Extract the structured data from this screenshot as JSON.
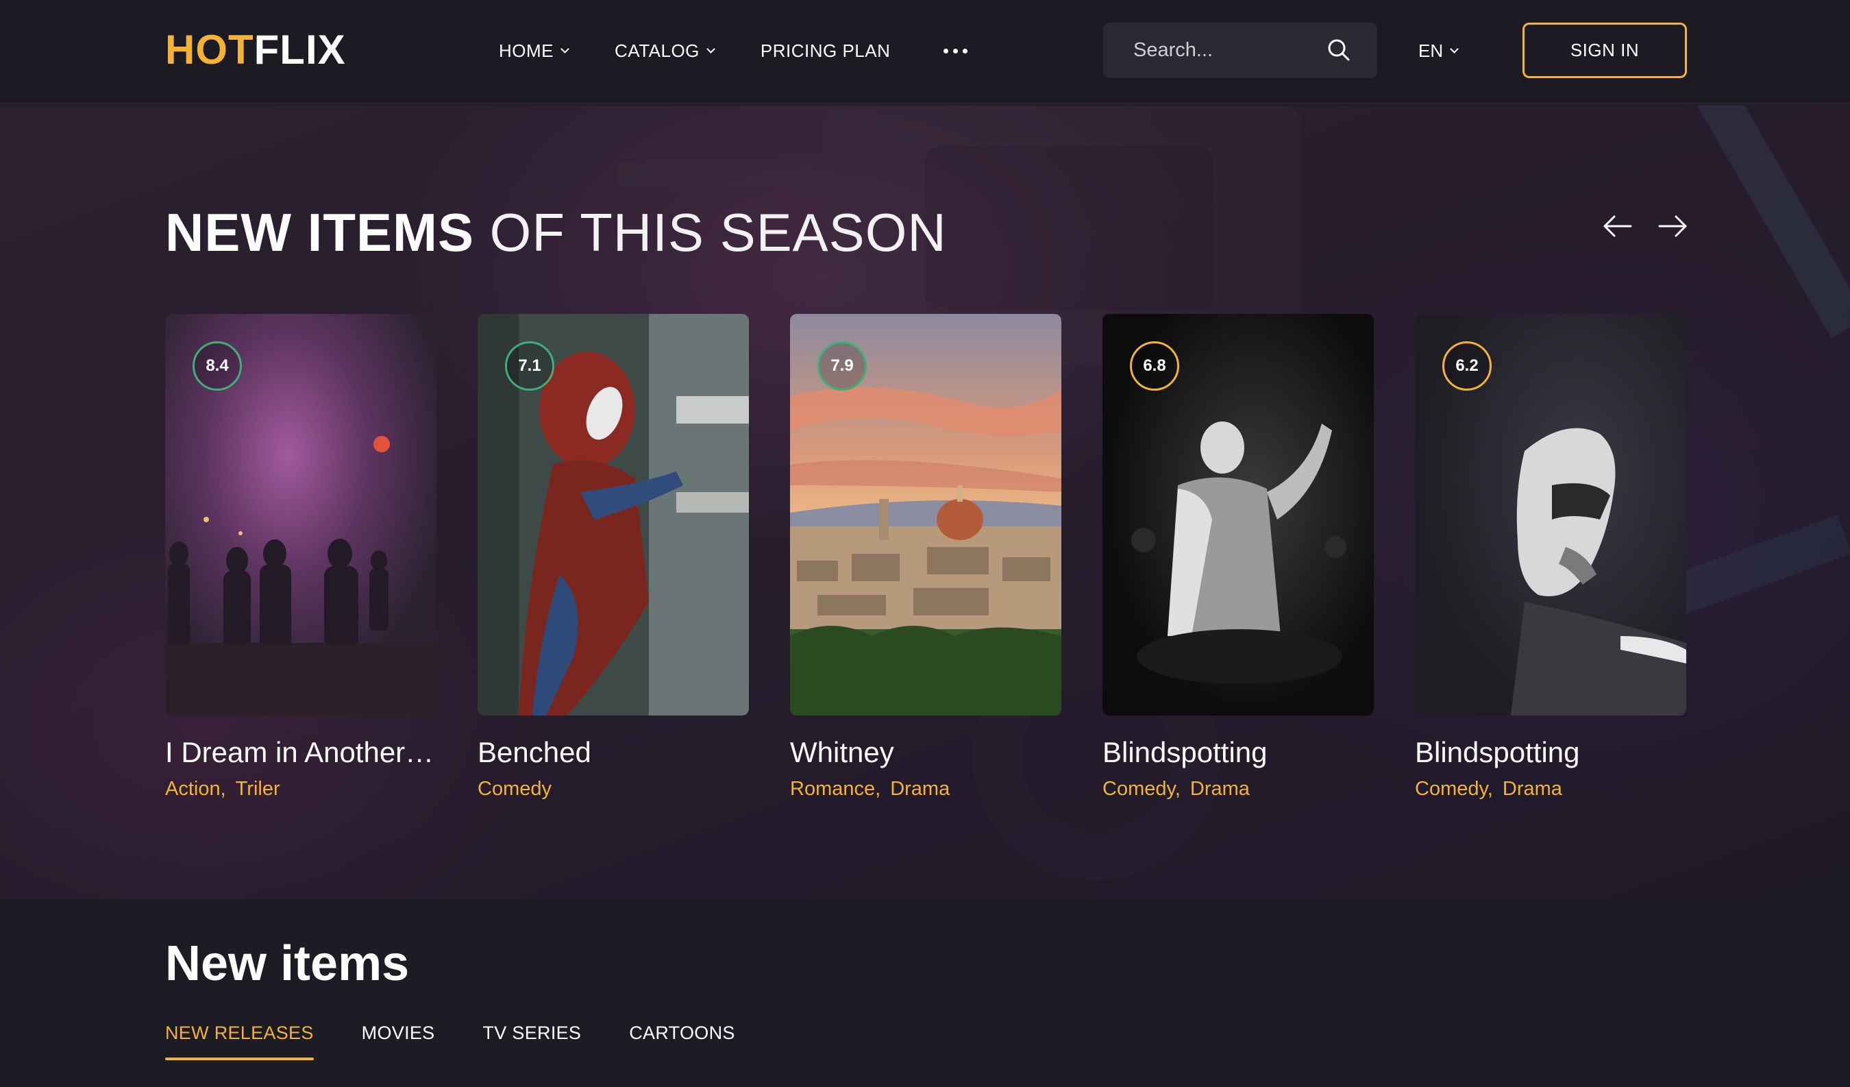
{
  "colors": {
    "accent": "#f5b335",
    "rating_green": "#3fb075",
    "rating_yellow": "#f5b335",
    "header_bg": "#1c1a22",
    "page_bg": "#1f1d26"
  },
  "header": {
    "logo_part1": "HOT",
    "logo_part2": "FLIX",
    "nav": {
      "home": "HOME",
      "catalog": "CATALOG",
      "pricing": "PRICING PLAN",
      "more_icon": "more-dots-icon"
    },
    "search": {
      "placeholder": "Search...",
      "icon": "search-icon"
    },
    "language": "EN",
    "sign_in": "SIGN IN"
  },
  "hero": {
    "title_strong": "NEW ITEMS",
    "title_light": "OF THIS SEASON",
    "prev_icon": "arrow-left-icon",
    "next_icon": "arrow-right-icon",
    "cards": [
      {
        "rating": "8.4",
        "rating_color": "green",
        "title": "I Dream in Another Language",
        "genres": [
          "Action",
          "Triler"
        ]
      },
      {
        "rating": "7.1",
        "rating_color": "green",
        "title": "Benched",
        "genres": [
          "Comedy"
        ]
      },
      {
        "rating": "7.9",
        "rating_color": "green",
        "title": "Whitney",
        "genres": [
          "Romance",
          "Drama"
        ]
      },
      {
        "rating": "6.8",
        "rating_color": "yellow",
        "title": "Blindspotting",
        "genres": [
          "Comedy",
          "Drama"
        ]
      },
      {
        "rating": "6.2",
        "rating_color": "yellow",
        "title": "Blindspotting",
        "genres": [
          "Comedy",
          "Drama"
        ]
      }
    ]
  },
  "new_items": {
    "title": "New items",
    "tabs": [
      "NEW RELEASES",
      "MOVIES",
      "TV SERIES",
      "CARTOONS"
    ],
    "active_tab": "NEW RELEASES"
  }
}
